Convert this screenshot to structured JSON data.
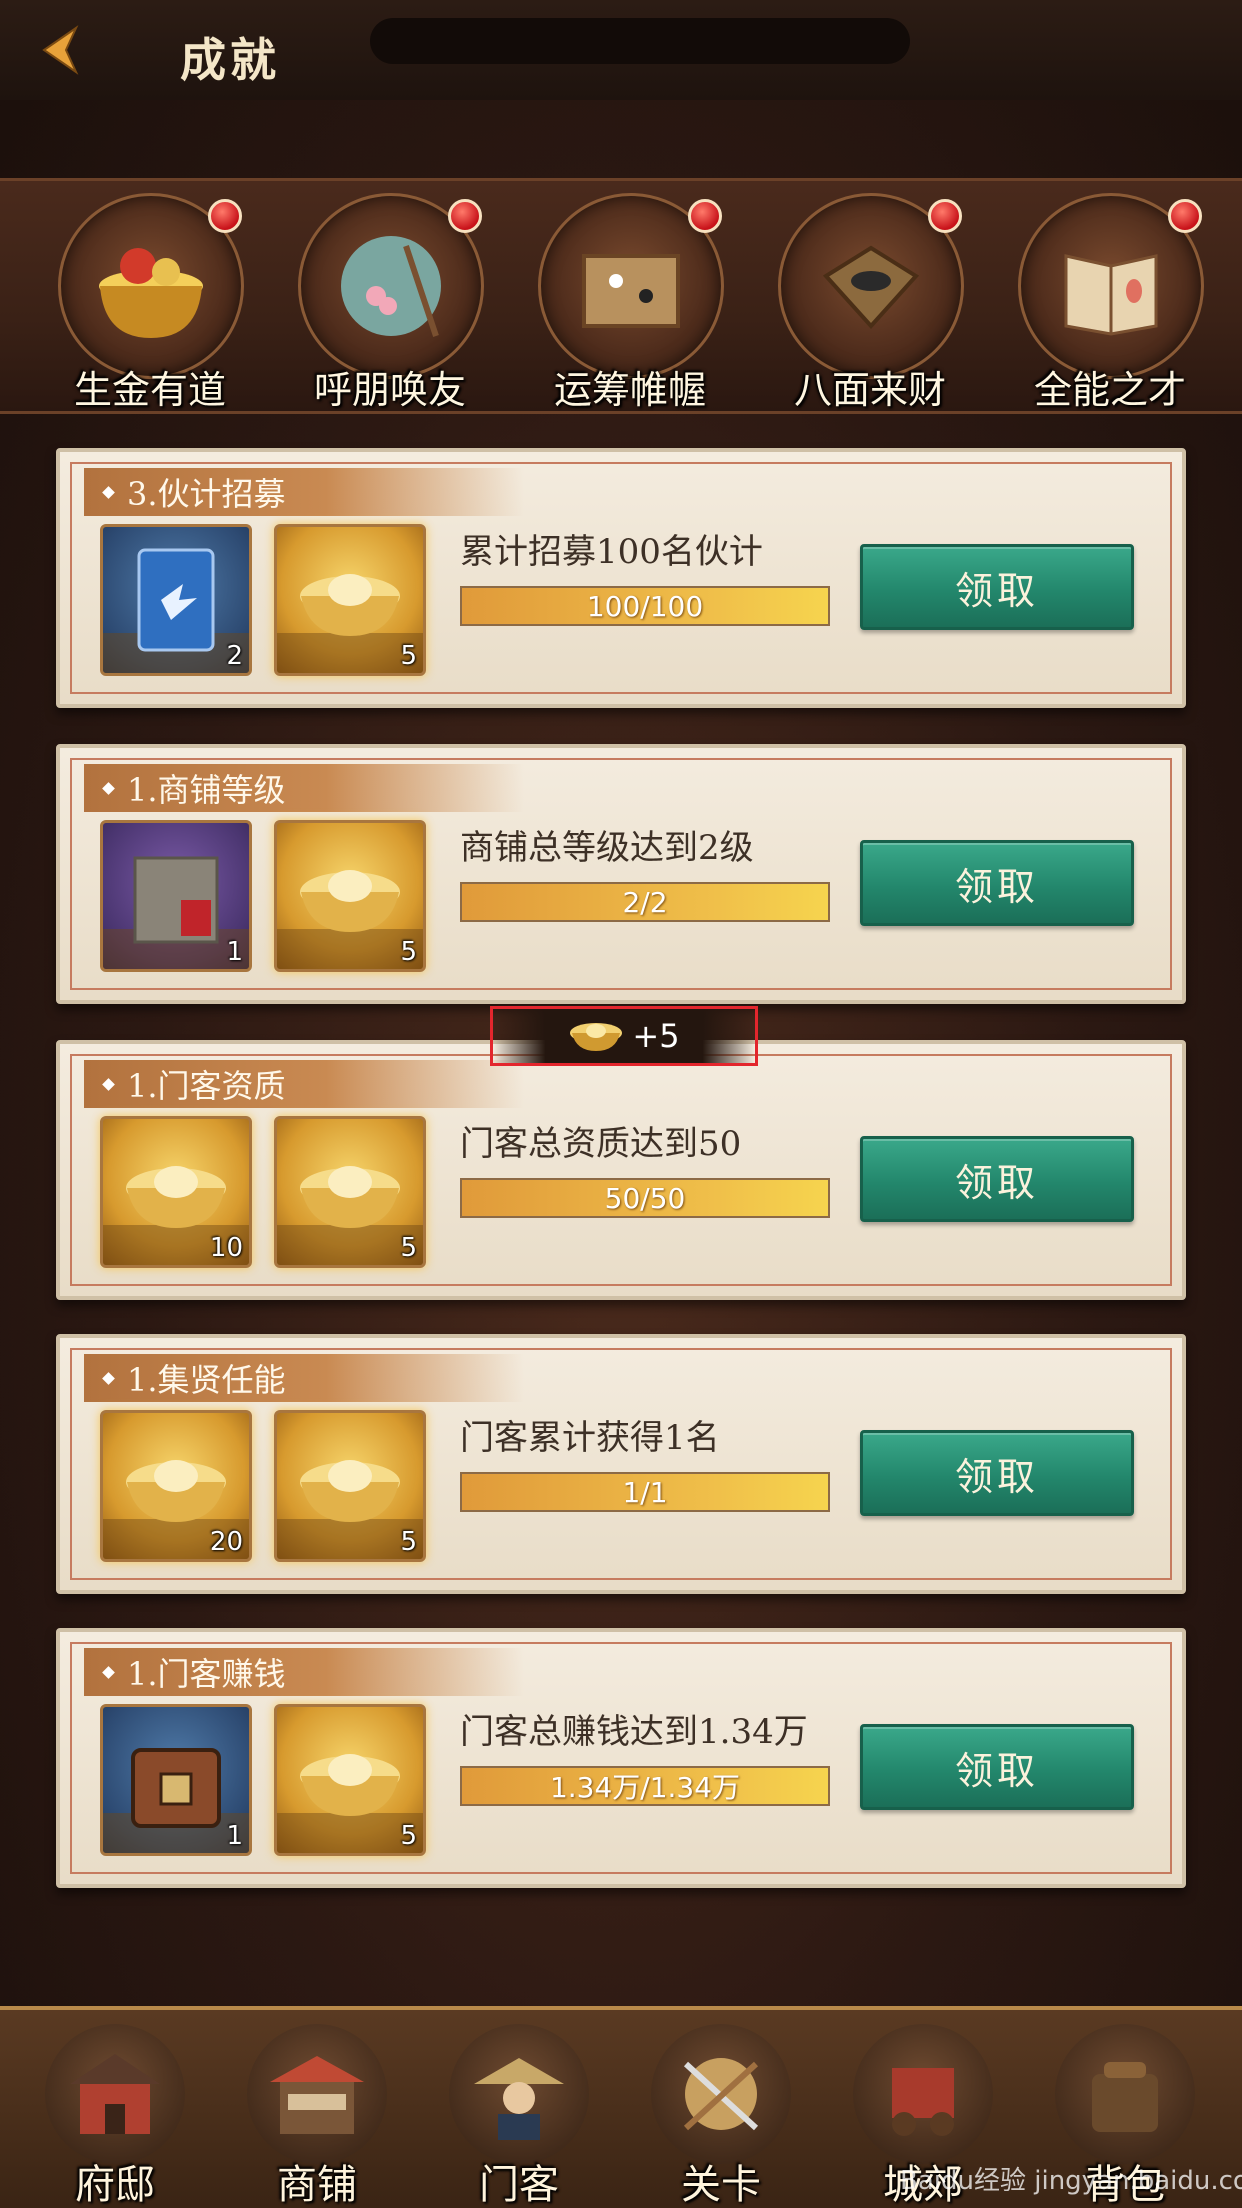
{
  "header": {
    "title": "成就"
  },
  "categories": [
    {
      "label": "生金有道",
      "icon": "gold-pot-icon"
    },
    {
      "label": "呼朋唤友",
      "icon": "fan-icon"
    },
    {
      "label": "运筹帷幄",
      "icon": "go-board-icon"
    },
    {
      "label": "八面来财",
      "icon": "abacus-tray-icon"
    },
    {
      "label": "全能之才",
      "icon": "book-icon"
    }
  ],
  "tasks": [
    {
      "tag": "3.伙计招募",
      "desc": "累计招募100名伙计",
      "progress_text": "100/100",
      "progress": 1.0,
      "rewards": [
        {
          "icon": "recruit-card-icon",
          "count": "2",
          "style": "blue"
        },
        {
          "icon": "gold-ingot-icon",
          "count": "5",
          "style": "gold"
        }
      ],
      "button": "领取"
    },
    {
      "tag": "1.商铺等级",
      "desc": "商铺总等级达到2级",
      "progress_text": "2/2",
      "progress": 1.0,
      "rewards": [
        {
          "icon": "book-bag-icon",
          "count": "1",
          "style": "purple"
        },
        {
          "icon": "gold-ingot-icon",
          "count": "5",
          "style": "gold"
        }
      ],
      "button": "领取"
    },
    {
      "tag": "1.门客资质",
      "desc": "门客总资质达到50",
      "progress_text": "50/50",
      "progress": 1.0,
      "rewards": [
        {
          "icon": "gold-ingot-icon",
          "count": "10",
          "style": "gold"
        },
        {
          "icon": "gold-ingot-icon",
          "count": "5",
          "style": "gold"
        }
      ],
      "button": "领取"
    },
    {
      "tag": "1.集贤任能",
      "desc": "门客累计获得1名",
      "progress_text": "1/1",
      "progress": 1.0,
      "rewards": [
        {
          "icon": "gold-ingot-icon",
          "count": "20",
          "style": "gold"
        },
        {
          "icon": "gold-ingot-icon",
          "count": "5",
          "style": "gold"
        }
      ],
      "button": "领取"
    },
    {
      "tag": "1.门客赚钱",
      "desc": "门客总赚钱达到1.34万",
      "progress_text": "1.34万/1.34万",
      "progress": 1.0,
      "rewards": [
        {
          "icon": "treasure-chest-icon",
          "count": "1",
          "style": "blue"
        },
        {
          "icon": "gold-ingot-icon",
          "count": "5",
          "style": "gold"
        }
      ],
      "button": "领取"
    }
  ],
  "toast": {
    "text": "+5",
    "icon": "gold-ingot-icon"
  },
  "bottom_nav": [
    {
      "label": "府邸",
      "icon": "mansion-icon"
    },
    {
      "label": "商铺",
      "icon": "shop-icon"
    },
    {
      "label": "门客",
      "icon": "retainer-icon"
    },
    {
      "label": "关卡",
      "icon": "stage-icon"
    },
    {
      "label": "城郊",
      "icon": "carriage-icon"
    },
    {
      "label": "背包",
      "icon": "backpack-icon"
    }
  ],
  "watermark": "Baidu经验 jingyan.baidu.com"
}
